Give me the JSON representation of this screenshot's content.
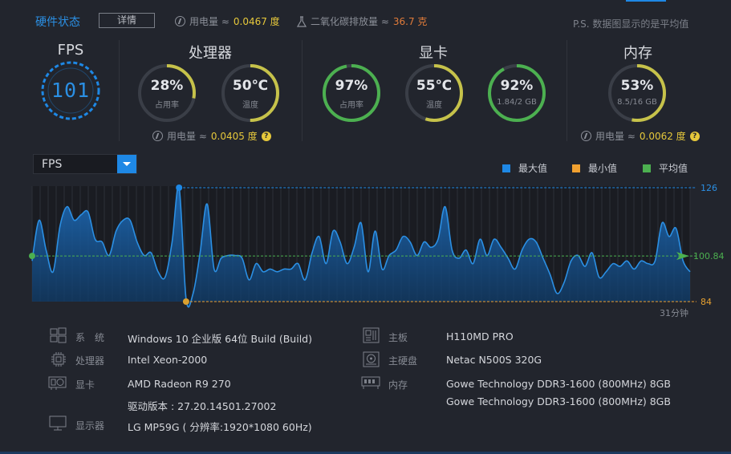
{
  "header": {
    "title": "硬件状态",
    "detail_button": "详情",
    "power_label": "用电量 ≈",
    "power_value": "0.0467 度",
    "co2_label": "二氧化碳排放量 ≈",
    "co2_value": "36.7 克",
    "note": "P.S. 数据图显示的是平均值"
  },
  "fps": {
    "title": "FPS",
    "value": "101"
  },
  "cpu": {
    "title": "处理器",
    "usage": {
      "value": "28%",
      "label": "占用率",
      "fraction": 0.28,
      "color": "#c6c24a"
    },
    "temp": {
      "value": "50℃",
      "label": "温度",
      "fraction": 0.5,
      "color": "#c6c24a"
    },
    "power_label": "用电量 ≈",
    "power_value": "0.0405 度"
  },
  "gpu": {
    "title": "显卡",
    "usage": {
      "value": "97%",
      "label": "占用率",
      "fraction": 0.97,
      "color": "#4cb050"
    },
    "temp": {
      "value": "55℃",
      "label": "温度",
      "fraction": 0.55,
      "color": "#c6c24a"
    },
    "mem": {
      "value": "92%",
      "label": "1.84/2 GB",
      "fraction": 0.92,
      "color": "#4cb050"
    }
  },
  "memory": {
    "title": "内存",
    "usage": {
      "value": "53%",
      "label": "8.5/16 GB",
      "fraction": 0.53,
      "color": "#c6c24a"
    },
    "power_label": "用电量 ≈",
    "power_value": "0.0062 度"
  },
  "chart_controls": {
    "selected": "FPS",
    "legend": [
      {
        "label": "最大值",
        "color": "#1e88e5"
      },
      {
        "label": "最小值",
        "color": "#f0a030"
      },
      {
        "label": "平均值",
        "color": "#4cb050"
      }
    ]
  },
  "chart_data": {
    "type": "area",
    "max_label": "126",
    "avg_label": "100.84",
    "min_label": "84",
    "duration_label": "31分钟",
    "ylim": [
      84,
      126
    ],
    "max": 126,
    "avg": 100.84,
    "min": 84,
    "grid": true,
    "values": [
      99,
      114,
      103,
      95,
      112,
      119,
      114,
      116,
      117,
      107,
      106,
      101,
      110,
      114,
      114,
      106,
      101,
      102,
      95,
      93,
      106,
      126,
      85,
      87,
      102,
      120,
      96,
      100,
      101,
      101,
      100,
      92,
      98,
      95,
      96,
      95,
      96,
      96,
      98,
      92,
      102,
      108,
      98,
      110,
      106,
      98,
      104,
      113,
      95,
      110,
      96,
      101,
      103,
      108,
      106,
      101,
      106,
      104,
      107,
      119,
      103,
      100,
      103,
      98,
      107,
      101,
      107,
      104,
      100,
      96,
      103,
      107,
      106,
      100,
      94,
      87,
      91,
      99,
      101,
      97,
      102,
      93,
      95,
      98,
      97,
      99,
      96,
      99,
      98,
      99,
      113,
      108,
      111,
      99,
      95
    ]
  },
  "info_left": [
    {
      "icon": "windows-icon",
      "label": "系　统",
      "values": [
        "Windows 10 企业版 64位   Build (Build)"
      ]
    },
    {
      "icon": "cpu-icon",
      "label": "处理器",
      "values": [
        "Intel Xeon-2000"
      ]
    },
    {
      "icon": "gpu-icon",
      "label": "显卡",
      "values": [
        "AMD Radeon R9 270",
        "驱动版本 : 27.20.14501.27002"
      ]
    },
    {
      "icon": "monitor-icon",
      "label": "显示器",
      "values": [
        "LG MP59G ( 分辨率:1920*1080 60Hz)"
      ]
    }
  ],
  "info_right": [
    {
      "icon": "motherboard-icon",
      "label": "主板",
      "values": [
        "H110MD PRO"
      ]
    },
    {
      "icon": "harddisk-icon",
      "label": "主硬盘",
      "values": [
        "Netac N500S 320G"
      ]
    },
    {
      "icon": "ram-icon",
      "label": "内存",
      "values": [
        "Gowe Technology DDR3-1600 (800MHz) 8GB",
        "Gowe Technology DDR3-1600 (800MHz) 8GB"
      ]
    }
  ]
}
